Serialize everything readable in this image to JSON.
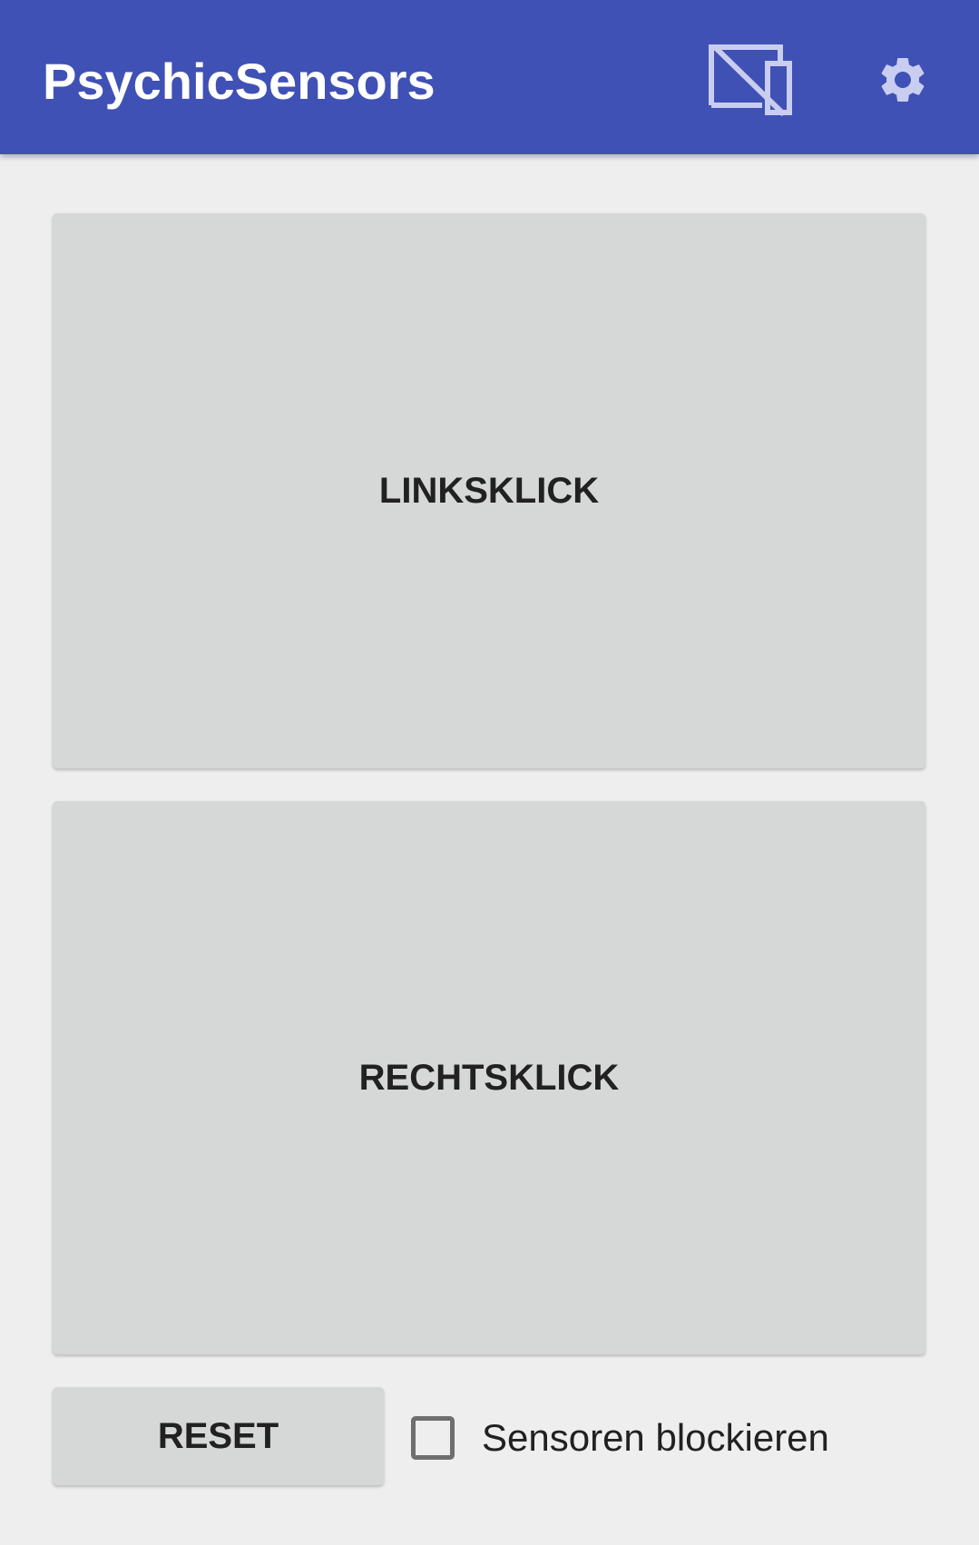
{
  "app_bar": {
    "title": "PsychicSensors",
    "background_color": "#3f51b5",
    "actions": [
      {
        "icon": "cast-off-icon"
      },
      {
        "icon": "gear-icon"
      }
    ]
  },
  "buttons": {
    "left_click_label": "LINKSKLICK",
    "right_click_label": "RECHTSKLICK",
    "reset_label": "RESET"
  },
  "block_sensors": {
    "label": "Sensoren blockieren",
    "checked": false
  }
}
